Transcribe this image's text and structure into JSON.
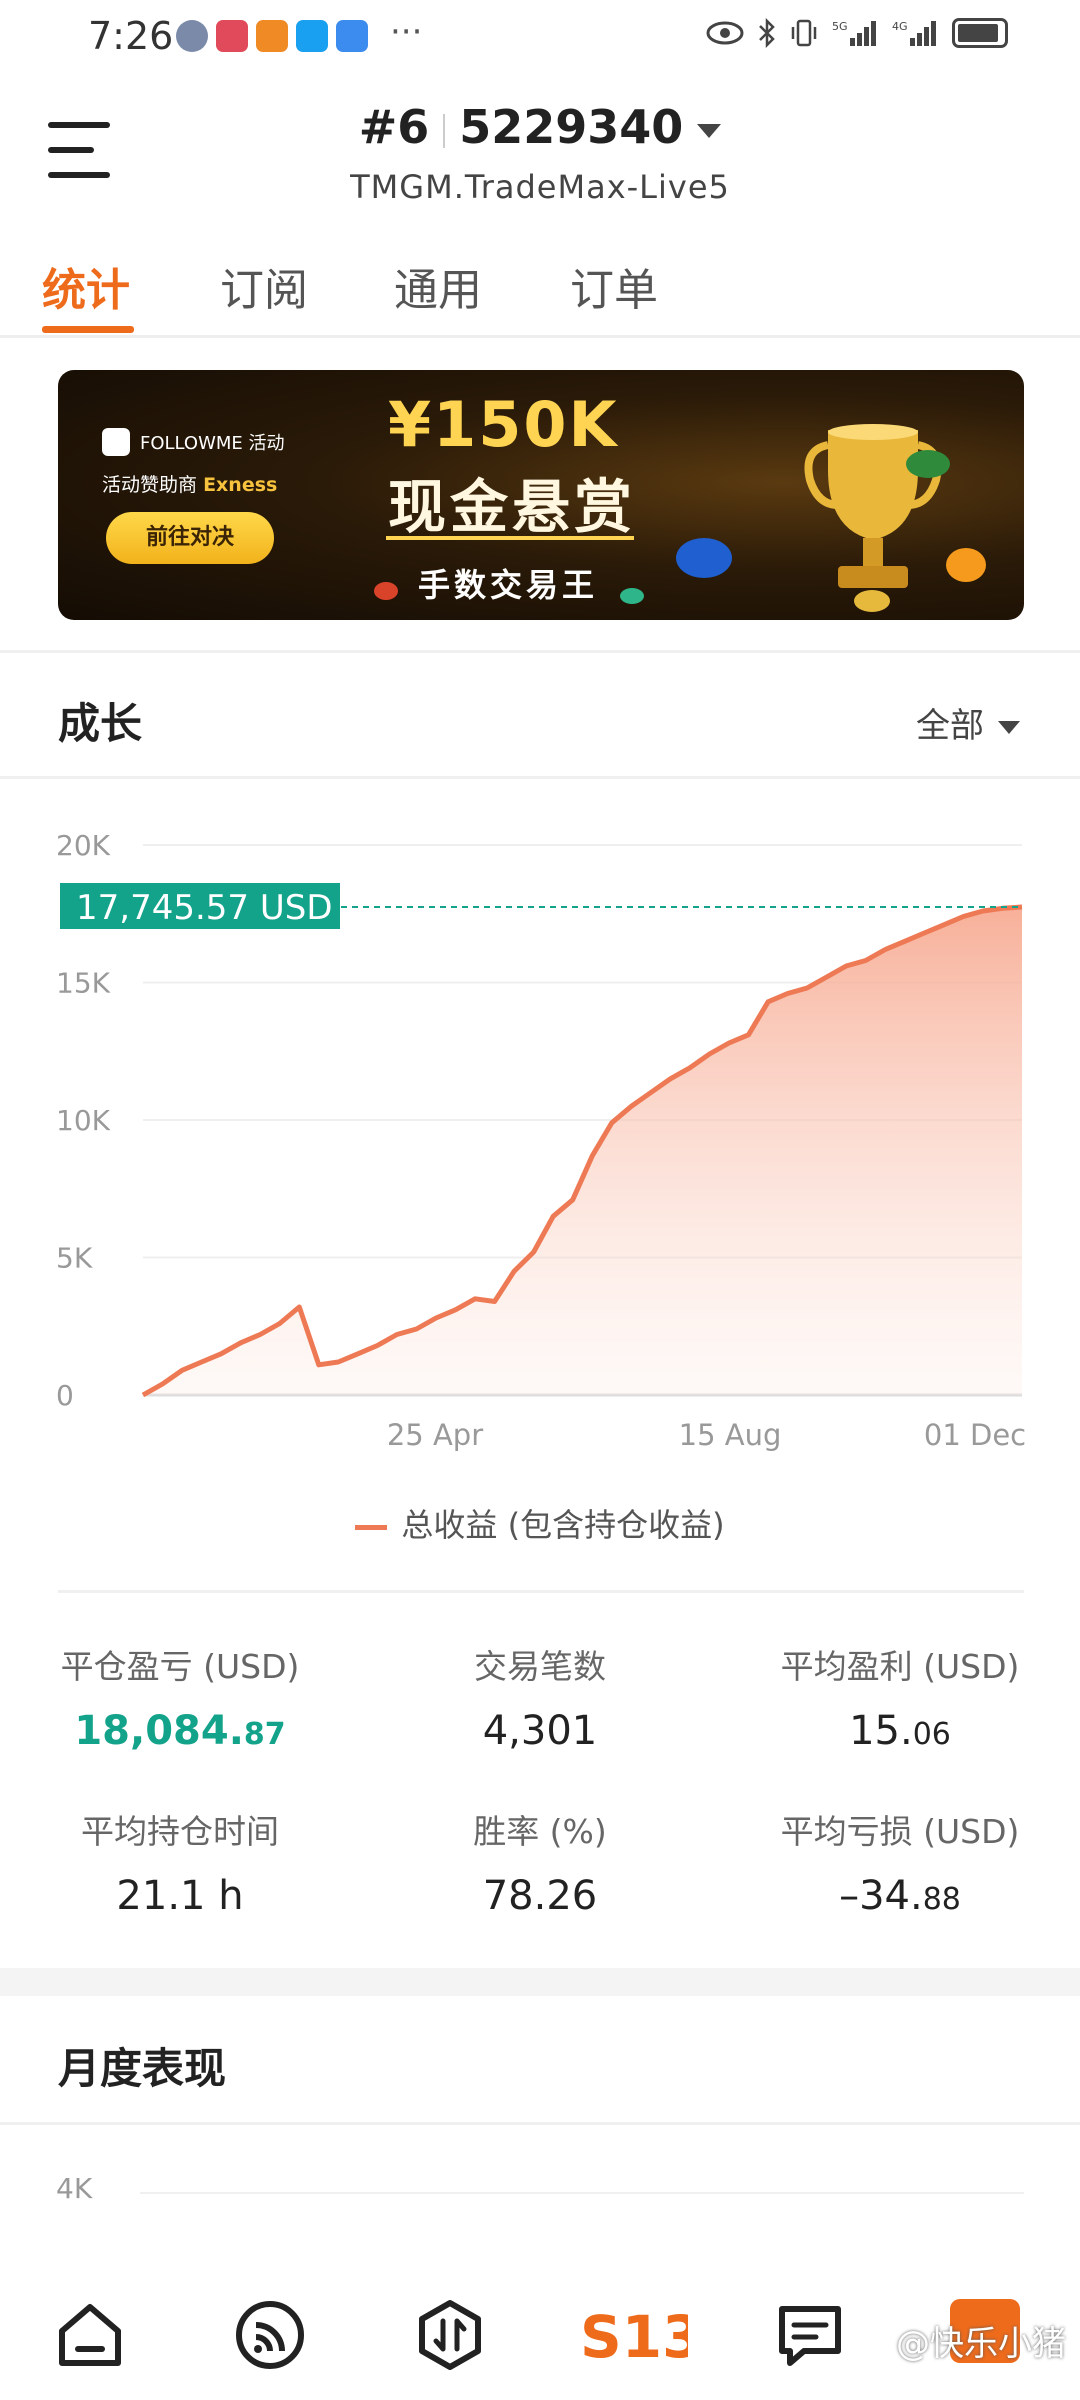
{
  "status_bar": {
    "time": "7:26",
    "more": "···"
  },
  "header": {
    "account_rank": "#6",
    "account_id": "5229340",
    "server": "TMGM.TradeMax-Live5"
  },
  "tabs": [
    "统计",
    "订阅",
    "通用",
    "订单"
  ],
  "banner": {
    "brand": "FOLLOWME 活动",
    "sponsor_prefix": "活动赞助商",
    "sponsor_name": "Exness",
    "cta": "前往对决",
    "amount": "¥150K",
    "headline": "现金悬赏",
    "tag": "手数交易王"
  },
  "growth": {
    "title": "成长",
    "period": "全部",
    "legend": "总收益 (包含持仓收益)"
  },
  "chart_data": {
    "type": "area",
    "ylim": [
      0,
      20000
    ],
    "yticks": [
      "20K",
      "15K",
      "10K",
      "5K",
      "0"
    ],
    "xticks": [
      "25 Apr",
      "15 Aug",
      "01 Dec"
    ],
    "current_label": "17,745.57 USD",
    "current_value": 17745.57,
    "series": [
      {
        "name": "总收益 (包含持仓收益)",
        "color": "#ee7a55",
        "x": [
          "start",
          "",
          "",
          "",
          "",
          "",
          "",
          "",
          "",
          "",
          "",
          "",
          "",
          "",
          "",
          "",
          "",
          "",
          "",
          "",
          "",
          "",
          "",
          "",
          "",
          "",
          "",
          "",
          "",
          "",
          "",
          "",
          "",
          "",
          "",
          "",
          "",
          "",
          "",
          "",
          "",
          "",
          "",
          "",
          "",
          "end"
        ],
        "values": [
          0,
          400,
          900,
          1200,
          1500,
          1900,
          2200,
          2600,
          3200,
          1100,
          1200,
          1500,
          1800,
          2200,
          2400,
          2800,
          3100,
          3500,
          3400,
          4500,
          5200,
          6500,
          7100,
          8700,
          9900,
          10500,
          11000,
          11500,
          11900,
          12400,
          12800,
          13100,
          14300,
          14600,
          14800,
          15200,
          15600,
          15800,
          16200,
          16500,
          16800,
          17100,
          17400,
          17600,
          17700,
          17745.57
        ]
      }
    ]
  },
  "stats": [
    {
      "label": "平仓盈亏 (USD)",
      "int": "18,084.",
      "dec": "87"
    },
    {
      "label": "交易笔数",
      "int": "4,301",
      "dec": ""
    },
    {
      "label": "平均盈利 (USD)",
      "int": "15.",
      "dec": "06"
    },
    {
      "label": "平均持仓时间",
      "int": "21.1 h",
      "dec": ""
    },
    {
      "label": "胜率 (%)",
      "int": "78.26",
      "dec": ""
    },
    {
      "label": "平均亏损 (USD)",
      "int": "–34.",
      "dec": "88"
    }
  ],
  "monthly": {
    "title": "月度表现",
    "axis_top": "4K"
  },
  "nav": {
    "watermark": "@快乐小猪"
  },
  "colors": {
    "accent": "#ee6b1c",
    "profit": "#13a38b",
    "line": "#ee7a55",
    "label_bg": "#13a38b"
  }
}
